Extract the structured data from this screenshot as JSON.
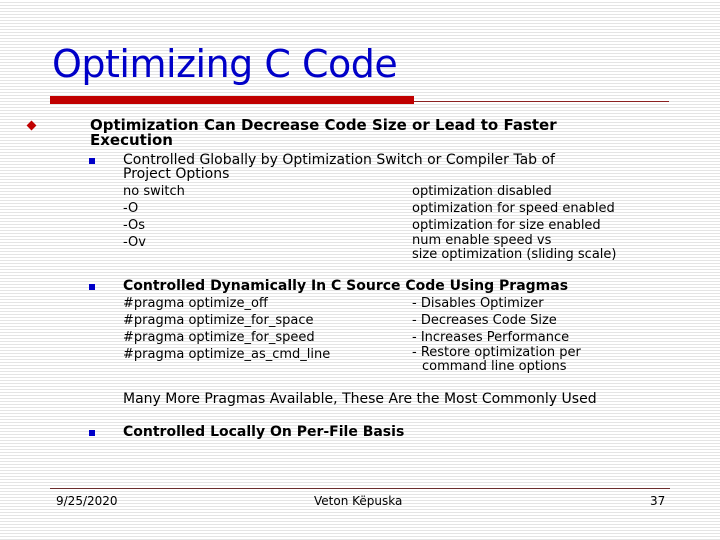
{
  "slide": {
    "title": "Optimizing C Code",
    "bullet1": {
      "text_line1": "Optimization Can Decrease Code Size or Lead to Faster",
      "text_line2": "Execution"
    },
    "sub1": {
      "text_line1": "Controlled Globally by Optimization Switch or Compiler Tab of",
      "text_line2": "Project Options",
      "switches": [
        {
          "switch": "no switch",
          "desc": "optimization disabled"
        },
        {
          "switch": "-O",
          "desc": "optimization for speed enabled"
        },
        {
          "switch": "-Os",
          "desc": "optimization for size enabled"
        },
        {
          "switch": "-Ov",
          "desc": "num enable speed vs",
          "desc2": "size optimization (sliding scale)"
        }
      ]
    },
    "sub2": {
      "text": "Controlled Dynamically In C Source Code Using Pragmas",
      "pragmas": [
        {
          "pragma": "#pragma optimize_off",
          "desc": "- Disables Optimizer"
        },
        {
          "pragma": "#pragma optimize_for_space",
          "desc": "- Decreases Code Size"
        },
        {
          "pragma": "#pragma optimize_for_speed",
          "desc": "- Increases Performance"
        },
        {
          "pragma": "#pragma optimize_as_cmd_line",
          "desc": "- Restore optimization per",
          "desc2": "command line options"
        }
      ],
      "note": "Many More Pragmas Available, These Are the Most Commonly Used"
    },
    "sub3": {
      "text": "Controlled Locally On Per-File Basis"
    }
  },
  "footer": {
    "date": "9/25/2020",
    "author": "Veton Këpuska",
    "page": "37"
  },
  "colors": {
    "title": "#0000c8",
    "accent_bar": "#c00000",
    "bullet_diamond": "#c00000",
    "bullet_square": "#0000c8"
  }
}
